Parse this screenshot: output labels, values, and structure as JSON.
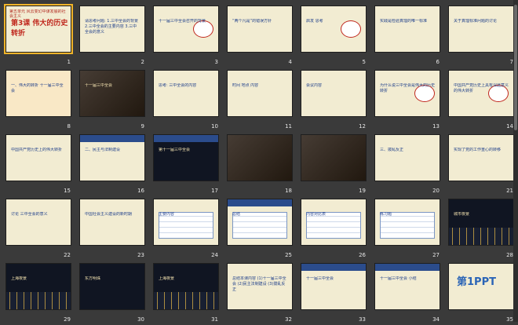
{
  "slides": [
    {
      "number": "1",
      "title": "第3课 伟大的历史转折",
      "lines": "第五单元 风云变幻中谋发展的社会主义"
    },
    {
      "number": "2",
      "title": "",
      "lines": "请思考问题: 1.三中全会的背景 2.三中全会的主要内容 3.三中全会的意义"
    },
    {
      "number": "3",
      "title": "",
      "lines": "十一届三中全会召开的背景"
    },
    {
      "number": "4",
      "title": "",
      "lines": "“两个凡是”的错误方针"
    },
    {
      "number": "5",
      "title": "",
      "lines": "启发 思考"
    },
    {
      "number": "6",
      "title": "",
      "lines": "实践是检验真理的唯一标准"
    },
    {
      "number": "7",
      "title": "",
      "lines": "关于真理标准问题的讨论"
    },
    {
      "number": "8",
      "title": "",
      "lines": "一、伟大的转折 十一届三中全会"
    },
    {
      "number": "9",
      "title": "",
      "lines": "十一届三中全会"
    },
    {
      "number": "10",
      "title": "",
      "lines": "思考: 三中全会的内容"
    },
    {
      "number": "11",
      "title": "",
      "lines": "时间 地点 内容"
    },
    {
      "number": "12",
      "title": "",
      "lines": "会议内容"
    },
    {
      "number": "13",
      "title": "",
      "lines": "为什么说三中全会是伟大的历史转折"
    },
    {
      "number": "14",
      "title": "",
      "lines": "中国共产党历史上具有深远意义的伟大转折"
    },
    {
      "number": "15",
      "title": "",
      "lines": "中国共产党历史上的伟大转折"
    },
    {
      "number": "16",
      "title": "",
      "lines": "二、民主与法制建设"
    },
    {
      "number": "17",
      "title": "",
      "lines": "第十一届三中全会"
    },
    {
      "number": "18",
      "title": "",
      "lines": ""
    },
    {
      "number": "19",
      "title": "",
      "lines": ""
    },
    {
      "number": "20",
      "title": "",
      "lines": "三、拨乱反正"
    },
    {
      "number": "21",
      "title": "",
      "lines": "实现了党的工作重心的转移"
    },
    {
      "number": "22",
      "title": "",
      "lines": "讨论 三中全会的意义"
    },
    {
      "number": "23",
      "title": "",
      "lines": "中国社会主义建设的新时期"
    },
    {
      "number": "24",
      "title": "",
      "lines": "主要内容"
    },
    {
      "number": "25",
      "title": "",
      "lines": "总结"
    },
    {
      "number": "26",
      "title": "",
      "lines": "内容对比表"
    },
    {
      "number": "27",
      "title": "",
      "lines": "练习题"
    },
    {
      "number": "28",
      "title": "",
      "lines": "城市夜景"
    },
    {
      "number": "29",
      "title": "",
      "lines": "上海夜景"
    },
    {
      "number": "30",
      "title": "",
      "lines": "东方明珠"
    },
    {
      "number": "31",
      "title": "",
      "lines": "上海夜景"
    },
    {
      "number": "32",
      "title": "",
      "lines": "总结本课内容 (1)十一届三中全会 (2)民主法制建设 (3)拨乱反正"
    },
    {
      "number": "33",
      "title": "",
      "lines": "十一届三中全会"
    },
    {
      "number": "34",
      "title": "",
      "lines": "十一届三中全会 小结"
    },
    {
      "number": "35",
      "title": "",
      "lines": "第1PPT"
    }
  ],
  "selected_slide": "1",
  "colors": {
    "background": "#3a3a3a",
    "accent": "#f0b429",
    "slide_bg": "#f2ecd2"
  }
}
